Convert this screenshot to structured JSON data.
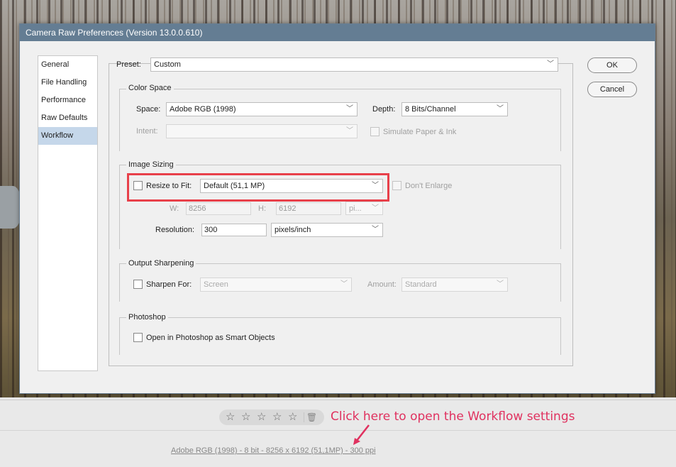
{
  "dialog": {
    "title": "Camera Raw Preferences  (Version 13.0.0.610)",
    "ok_label": "OK",
    "cancel_label": "Cancel"
  },
  "sidebar": {
    "items": [
      {
        "label": "General"
      },
      {
        "label": "File Handling"
      },
      {
        "label": "Performance"
      },
      {
        "label": "Raw Defaults"
      },
      {
        "label": "Workflow",
        "active": true
      }
    ]
  },
  "preset": {
    "label": "Preset:",
    "value": "Custom"
  },
  "color_space": {
    "title": "Color Space",
    "space_label": "Space:",
    "space_value": "Adobe RGB (1998)",
    "depth_label": "Depth:",
    "depth_value": "8 Bits/Channel",
    "intent_label": "Intent:",
    "intent_value": "",
    "simulate_label": "Simulate Paper & Ink"
  },
  "image_sizing": {
    "title": "Image Sizing",
    "resize_label": "Resize to Fit:",
    "resize_value": "Default  (51,1 MP)",
    "dont_enlarge_label": "Don't Enlarge",
    "w_label": "W:",
    "w_value": "8256",
    "h_label": "H:",
    "h_value": "6192",
    "unit_value": "pi...",
    "resolution_label": "Resolution:",
    "resolution_value": "300",
    "resolution_unit": "pixels/inch"
  },
  "output_sharpening": {
    "title": "Output Sharpening",
    "sharpen_label": "Sharpen For:",
    "sharpen_value": "Screen",
    "amount_label": "Amount:",
    "amount_value": "Standard"
  },
  "photoshop": {
    "title": "Photoshop",
    "smart_objects_label": "Open in Photoshop as Smart Objects"
  },
  "bottom": {
    "callout": "Click here to open the Workflow settings",
    "workflow_link": "Adobe RGB (1998) - 8 bit - 8256 x 6192 (51,1MP) - 300 ppi",
    "stars": [
      "☆",
      "☆",
      "☆",
      "☆",
      "☆"
    ],
    "trash_icon": "🗑"
  },
  "colors": {
    "titlebar": "#647d93",
    "highlight": "#e8404a",
    "callout": "#e0315f",
    "active_item": "#c5d7ea"
  }
}
